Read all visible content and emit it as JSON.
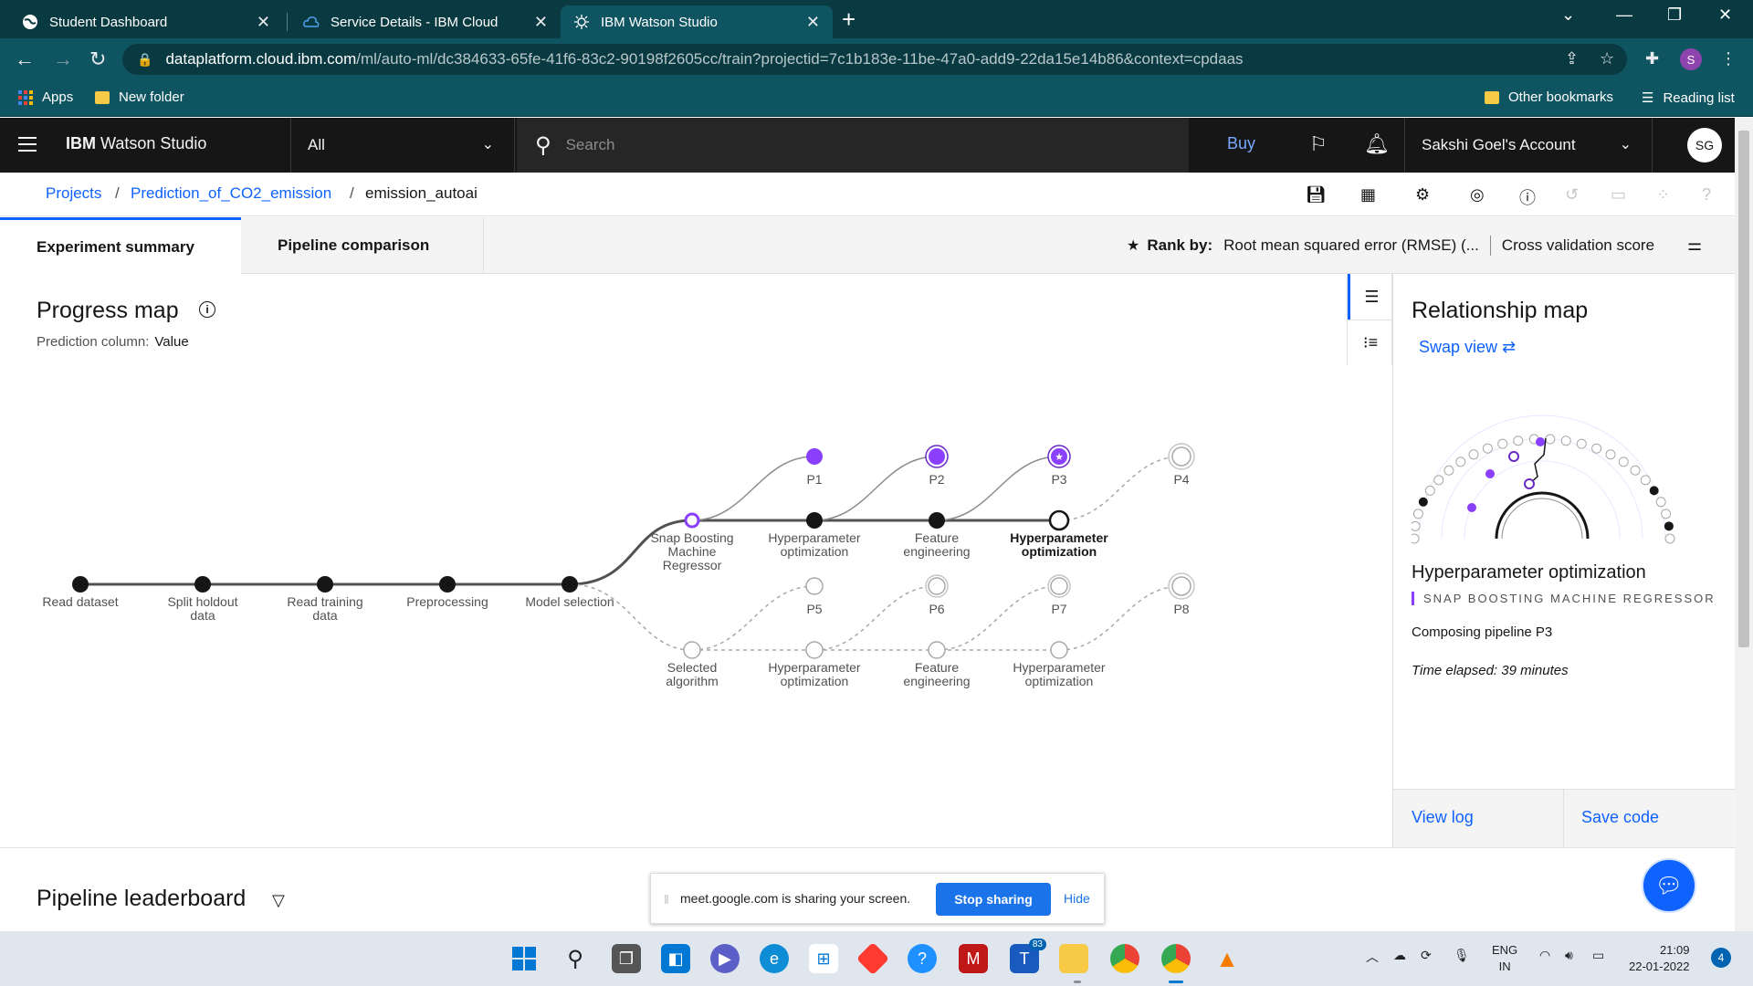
{
  "browser": {
    "tabs": [
      {
        "title": "Student Dashboard"
      },
      {
        "title": "Service Details - IBM Cloud"
      },
      {
        "title": "IBM Watson Studio"
      }
    ],
    "url_host": "dataplatform.cloud.ibm.com",
    "url_path": "/ml/auto-ml/dc384633-65fe-41f6-83c2-90198f2605cc/train?projectid=7c1b183e-11be-47a0-add9-22da15e14b86&context=cpdaas",
    "profile_initial": "S",
    "bookmarks": {
      "apps": "Apps",
      "folder": "New folder",
      "other": "Other bookmarks",
      "reading": "Reading list"
    }
  },
  "header": {
    "brand_strong": "IBM",
    "brand_rest": "Watson Studio",
    "scope": "All",
    "search_placeholder": "Search",
    "buy": "Buy",
    "account": "Sakshi Goel's Account",
    "avatar": "SG"
  },
  "breadcrumb": {
    "projects": "Projects",
    "project": "Prediction_of_CO2_emission",
    "current": "emission_autoai",
    "sep": "/"
  },
  "tabs": {
    "summary": "Experiment summary",
    "comparison": "Pipeline comparison"
  },
  "rank": {
    "label": "Rank by:",
    "metric": "Root mean squared error (RMSE) (...",
    "score": "Cross validation score"
  },
  "progress_map": {
    "title": "Progress map",
    "prediction_label": "Prediction column:",
    "prediction_value": "Value",
    "main_nodes": [
      {
        "label": "Read dataset"
      },
      {
        "label": "Split holdout\ndata"
      },
      {
        "label": "Read training\ndata"
      },
      {
        "label": "Preprocessing"
      },
      {
        "label": "Model selection"
      }
    ],
    "upper": [
      {
        "label": "Snap Boosting\nMachine\nRegressor"
      },
      {
        "label": "Hyperparameter\noptimization"
      },
      {
        "label": "Feature\nengineering"
      },
      {
        "label": "Hyperparameter\noptimization"
      }
    ],
    "lower": [
      {
        "label": "Selected\nalgorithm"
      },
      {
        "label": "Hyperparameter\noptimization"
      },
      {
        "label": "Feature\nengineering"
      },
      {
        "label": "Hyperparameter\noptimization"
      }
    ],
    "pipelines_top": [
      "P1",
      "P2",
      "P3",
      "P4"
    ],
    "pipelines_bottom": [
      "P5",
      "P6",
      "P7",
      "P8"
    ]
  },
  "relationship": {
    "title": "Relationship map",
    "swap": "Swap view",
    "stage": "Hyperparameter optimization",
    "algorithm": "SNAP BOOSTING MACHINE REGRESSOR",
    "composing": "Composing pipeline P3",
    "elapsed": "Time elapsed: 39 minutes",
    "view_log": "View log",
    "save_code": "Save code"
  },
  "leaderboard": {
    "title": "Pipeline leaderboard"
  },
  "sharing": {
    "message": "meet.google.com is sharing your screen.",
    "stop": "Stop sharing",
    "hide": "Hide"
  },
  "taskbar": {
    "lang1": "ENG",
    "lang2": "IN",
    "time": "21:09",
    "date": "22-01-2022",
    "notifications": "4",
    "teams_badge": "83"
  },
  "colors": {
    "ibm_blue": "#0f62fe",
    "purple": "#8a3ffc",
    "dark_purple": "#6929c4",
    "header": "#161616",
    "chrome_tab": "#0a3a41"
  }
}
